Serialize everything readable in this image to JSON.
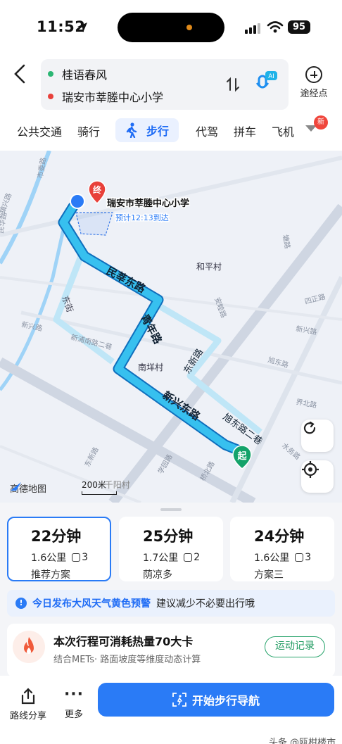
{
  "status": {
    "time": "11:52",
    "battery": "95"
  },
  "route": {
    "origin": "桂语春风",
    "destination": "瑞安市莘塍中心小学",
    "waypoint_label": "途经点",
    "ai_label": "AI",
    "colors": {
      "origin": "#2bb673",
      "destination": "#e8403a"
    }
  },
  "modes": {
    "transit": "公共交通",
    "bike": "骑行",
    "walk": "步行",
    "chauffeur": "代驾",
    "carpool": "拼车",
    "flight": "飞机",
    "new_badge": "新"
  },
  "map": {
    "dest_pin": "终",
    "origin_pin": "起",
    "dest_name": "瑞安市莘塍中心小学",
    "eta": "预计12:13到达",
    "road_labels": {
      "minhua_east": "民莘东路",
      "qingnian": "青年路",
      "xinxing_east": "新兴东路",
      "xudong_2": "旭东路二巷",
      "dongxin": "东新路",
      "dongjie": "东街",
      "heping": "和平村",
      "nanyang": "南垟村",
      "minhua": "民华路",
      "xinxing": "新兴路",
      "xinpu_2": "新浦南路二巷",
      "tanglu": "塘路",
      "xudong": "旭东路",
      "dongxin_lower": "东新路",
      "anmu": "安睦路",
      "sizheng": "四正路",
      "shuiwu": "水务路",
      "qiaobei": "桥北路",
      "xuexi": "学园路",
      "shiwei": "市委路",
      "zhenxing": "镇兴路",
      "xinxing_lane": "新兴路",
      "jiebei": "界北路"
    },
    "logo": "高德地图",
    "scale": "200米",
    "scale_overlap": "千阳村"
  },
  "plans": [
    {
      "duration": "22分钟",
      "distance": "1.6公里",
      "lights": "3",
      "tag": "推荐方案"
    },
    {
      "duration": "25分钟",
      "distance": "1.7公里",
      "lights": "2",
      "tag": "荫凉多"
    },
    {
      "duration": "24分钟",
      "distance": "1.6公里",
      "lights": "3",
      "tag": "方案三"
    }
  ],
  "warning": {
    "icon": "!",
    "highlight": "今日发布大风天气黄色预警",
    "text": "建议减少不必要出行哦"
  },
  "calories": {
    "title": "本次行程可消耗热量70大卡",
    "subtitle": "结合METs· 路面坡度等维度动态计算",
    "button": "运动记录"
  },
  "bottom": {
    "share": "路线分享",
    "more": "更多",
    "more_dots": "···",
    "navigate": "开始步行导航"
  },
  "watermark": "头条 @瓯柑楼市"
}
